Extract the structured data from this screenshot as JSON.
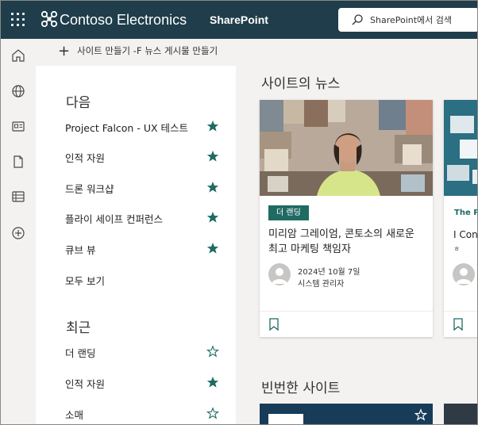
{
  "suite_bar": {
    "brand": "Contoso Electronics",
    "app": "SharePoint",
    "search_placeholder": "SharePoint에서 검색",
    "colors": {
      "background": "#1f3d4a",
      "accent": "#1f6b63"
    }
  },
  "rail": {
    "items": [
      {
        "name": "home-icon"
      },
      {
        "name": "globe-icon"
      },
      {
        "name": "news-icon"
      },
      {
        "name": "document-icon"
      },
      {
        "name": "lists-icon"
      },
      {
        "name": "add-circle-icon"
      }
    ]
  },
  "command_bar": {
    "create_label": "사이트 만들기 -F  뉴스 게시물 만들기"
  },
  "following": {
    "title": "다음",
    "items": [
      {
        "label": "Project Falcon - UX 테스트",
        "starred": true
      },
      {
        "label": "인적 자원",
        "starred": true
      },
      {
        "label": "드론 워크샵",
        "starred": true
      },
      {
        "label": "플라이 세이프 컨퍼런스",
        "starred": true
      },
      {
        "label": "큐브 뷰",
        "starred": true
      }
    ],
    "see_all": "모두 보기"
  },
  "recent": {
    "title": "최근",
    "items": [
      {
        "label": "더 랜딩",
        "starred": false
      },
      {
        "label": "인적 자원",
        "starred": true
      },
      {
        "label": "소매",
        "starred": false
      }
    ]
  },
  "news": {
    "title": "사이트의 뉴스",
    "cards": [
      {
        "tag": "더 랜딩",
        "title": "미리암 그레이엄, 콘토소의 새로운 최고 마케팅 책임자",
        "date": "2024년 10월 7일",
        "author": "시스템 관리자"
      },
      {
        "category": "The Pe",
        "title": "I Cont",
        "sub": "ㅎ"
      }
    ]
  },
  "frequent": {
    "title": "빈번한 사이트"
  }
}
